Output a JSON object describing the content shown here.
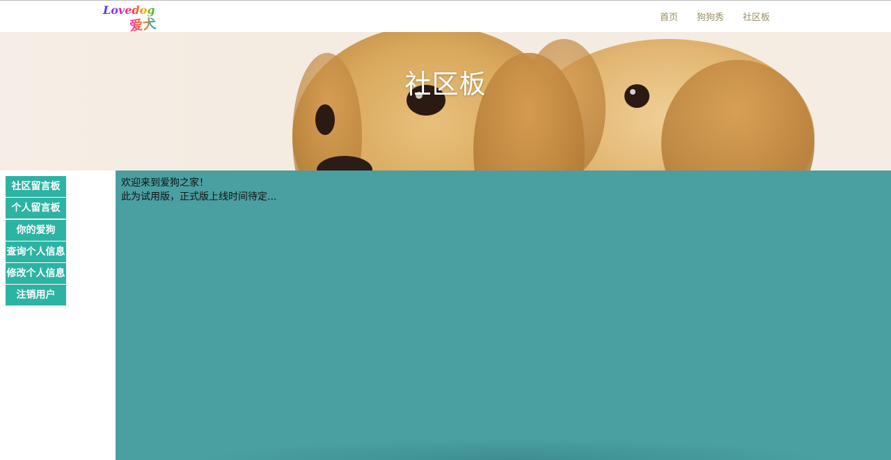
{
  "logo": {
    "text_top": "Lovedog",
    "text_bottom": "爱犬"
  },
  "nav": {
    "items": [
      {
        "label": "首页"
      },
      {
        "label": "狗狗秀"
      },
      {
        "label": "社区板"
      }
    ],
    "color": "#9a8f62"
  },
  "banner": {
    "title": "社区板"
  },
  "sidebar": {
    "items": [
      {
        "label": "社区留言板"
      },
      {
        "label": "个人留言板"
      },
      {
        "label": "你的爱狗"
      },
      {
        "label": "查询个人信息"
      },
      {
        "label": "修改个人信息"
      },
      {
        "label": "注销用户"
      }
    ],
    "color": "#2cb3a3"
  },
  "content": {
    "lines": [
      "欢迎来到爱狗之家！",
      "此为试用版，正式版上线时间待定..."
    ],
    "background": "#4a9fa1"
  }
}
